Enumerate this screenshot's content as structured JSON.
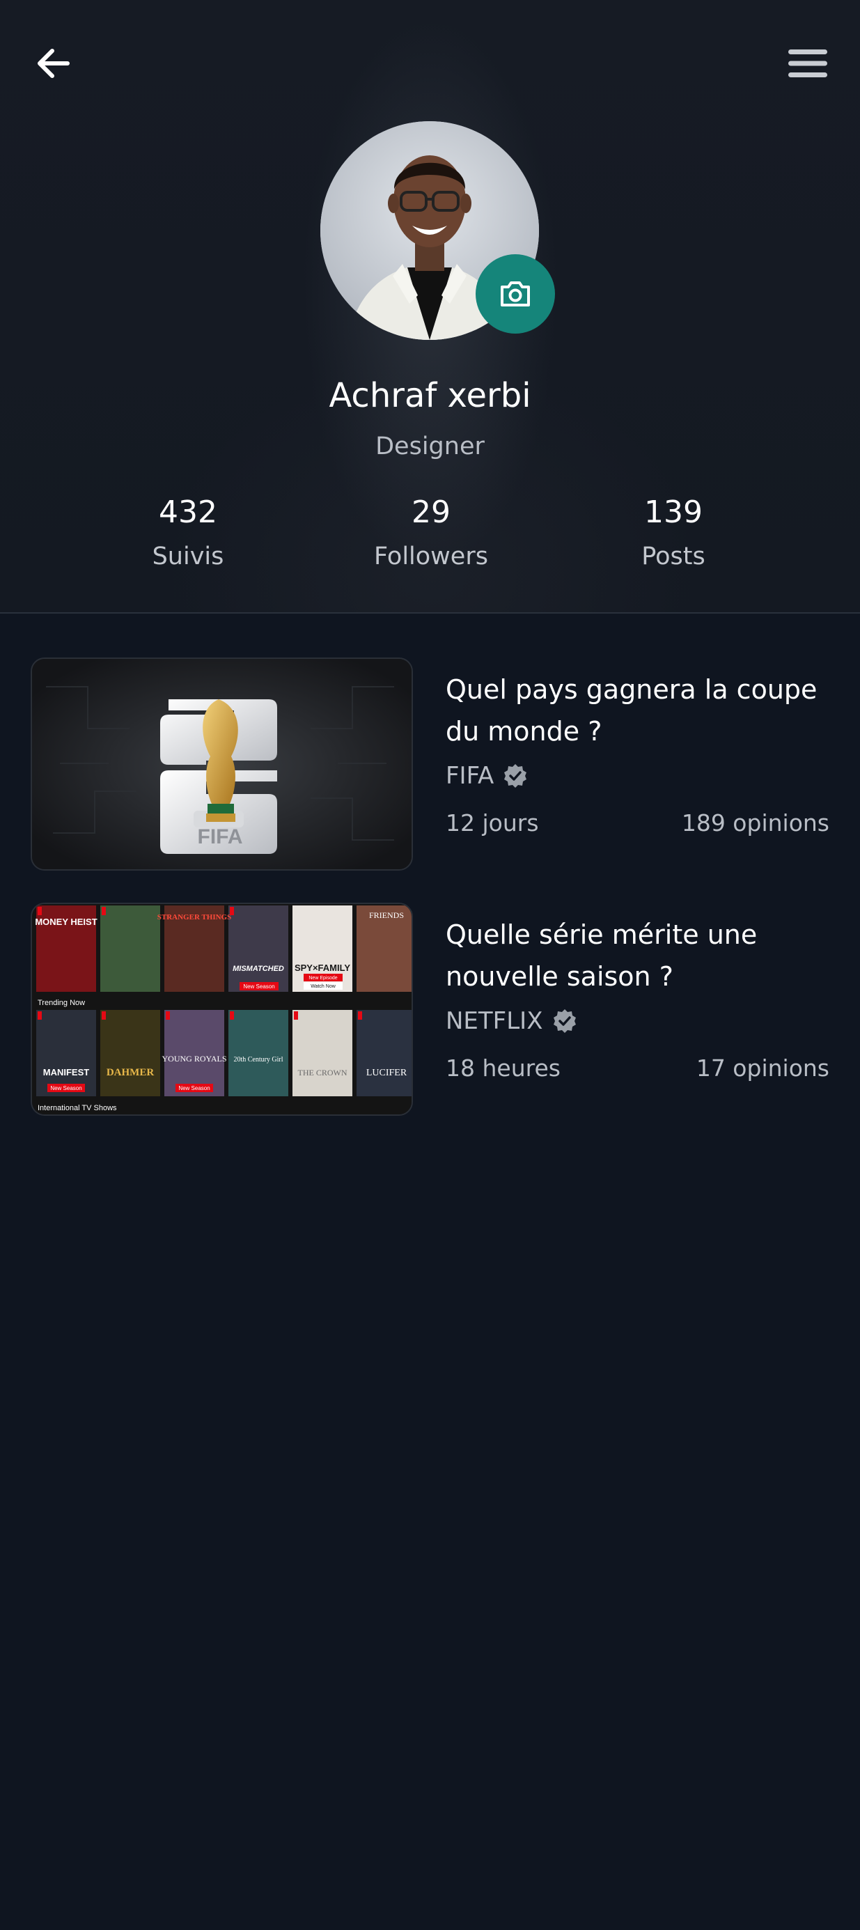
{
  "profile": {
    "name": "Achraf xerbi",
    "role": "Designer"
  },
  "stats": [
    {
      "value": "432",
      "label": "Suivis"
    },
    {
      "value": "29",
      "label": "Followers"
    },
    {
      "value": "139",
      "label": "Posts"
    }
  ],
  "icons": {
    "back": "arrow-left-icon",
    "menu": "hamburger-menu-icon",
    "camera": "camera-icon",
    "verified": "verified-badge-icon"
  },
  "colors": {
    "background": "#0f1520",
    "accent": "#15857a",
    "text_primary": "#ffffff",
    "text_secondary": "#b9bec6"
  },
  "posts": [
    {
      "title": "Quel pays gagnera la coupe du monde ?",
      "source": "FIFA",
      "time": "12 jours",
      "opinions": "189 opinions",
      "thumbnail_text": "FIFA"
    },
    {
      "title": "Quelle série mérite une nouvelle saison ?",
      "source": "NETFLIX",
      "time": "18 heures",
      "opinions": "17 opinions",
      "thumbnail_titles": [
        "MONEY HEIST",
        "STRANGER THINGS",
        "MISMATCHED",
        "SPY×FAMILY",
        "FRIENDS",
        "MANIFEST",
        "DAHMER",
        "YOUNG ROYALS",
        "20th Century Girl",
        "THE CROWN",
        "LUCIFER"
      ],
      "thumbnail_badges": [
        "New Season",
        "New Episode",
        "Watch Now",
        "New Season",
        "New Season"
      ],
      "thumbnail_rows": [
        "Trending Now",
        "International TV Shows"
      ]
    }
  ]
}
